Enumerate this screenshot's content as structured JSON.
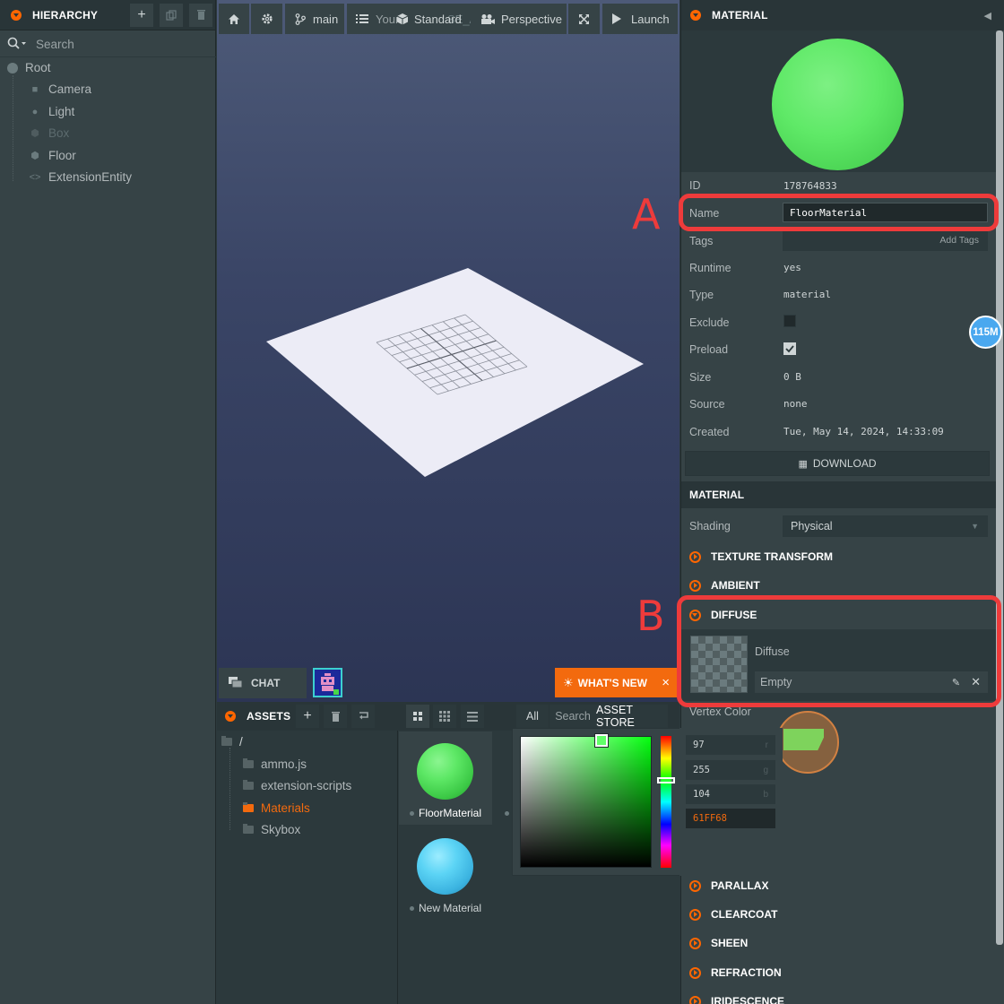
{
  "hierarchy": {
    "title": "HIERARCHY",
    "search_placeholder": "Search",
    "items": [
      {
        "label": "Root"
      },
      {
        "label": "Camera"
      },
      {
        "label": "Light"
      },
      {
        "label": "Box"
      },
      {
        "label": "Floor"
      },
      {
        "label": "ExtensionEntity"
      }
    ]
  },
  "toolbar": {
    "branch": "main",
    "scene_overlap": "Your",
    "scene_overlap2": "SE_App",
    "render_mode": "Standard",
    "camera": "Perspective",
    "launch": "Launch"
  },
  "bottom": {
    "chat": "CHAT",
    "whats_new": "WHAT'S NEW",
    "close": "×"
  },
  "assets": {
    "title": "ASSETS",
    "filter_all": "All",
    "search_placeholder": "Search",
    "store": "ASSET STORE",
    "root": "/",
    "folders": [
      {
        "label": "ammo.js"
      },
      {
        "label": "extension-scripts"
      },
      {
        "label": "Materials"
      },
      {
        "label": "Skybox"
      }
    ],
    "items": [
      {
        "label": "FloorMaterial"
      },
      {
        "label": "New Material"
      }
    ]
  },
  "inspector": {
    "title": "MATERIAL",
    "fields": {
      "id_label": "ID",
      "id_value": "178764833",
      "name_label": "Name",
      "name_value": "FloorMaterial",
      "tags_label": "Tags",
      "tags_placeholder": "Add Tags",
      "runtime_label": "Runtime",
      "runtime_value": "yes",
      "type_label": "Type",
      "type_value": "material",
      "exclude_label": "Exclude",
      "preload_label": "Preload",
      "size_label": "Size",
      "size_value": "0 B",
      "source_label": "Source",
      "source_value": "none",
      "created_label": "Created",
      "created_value": "Tue, May 14, 2024, 14:33:09"
    },
    "download": "DOWNLOAD",
    "material_section": "MATERIAL",
    "shading_label": "Shading",
    "shading_value": "Physical",
    "sections": {
      "texture_transform": "TEXTURE TRANSFORM",
      "ambient": "AMBIENT",
      "diffuse": "DIFFUSE",
      "parallax": "PARALLAX",
      "clearcoat": "CLEARCOAT",
      "sheen": "SHEEN",
      "refraction": "REFRACTION",
      "iridescence": "IRIDESCENCE"
    },
    "diffuse_label": "Diffuse",
    "diffuse_texture": "Empty",
    "vertex_color": "Vertex Color",
    "memory_badge": "115M"
  },
  "color_picker": {
    "r": "97",
    "g": "255",
    "b": "104",
    "r_label": "r",
    "g_label": "g",
    "b_label": "b",
    "hex": "61FF68",
    "color": "#61ff68"
  },
  "annotations": {
    "a": "A",
    "b": "B"
  }
}
